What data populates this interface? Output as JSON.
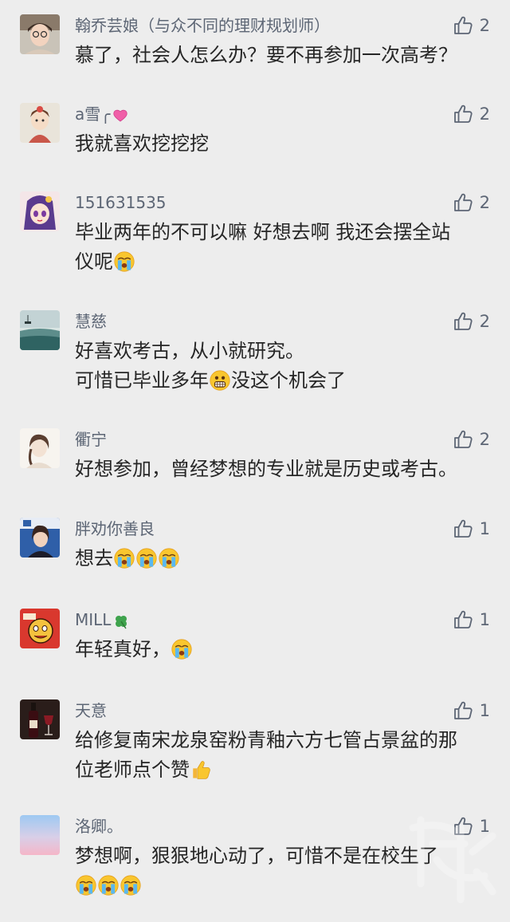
{
  "comments": [
    {
      "name": "翰乔芸娘（与众不同的理财规划师）",
      "likes": "2",
      "text_lines": [
        "慕了，社会人怎么办？要不再参加一次高考？"
      ],
      "avatar": "woman-glasses-avatar"
    },
    {
      "name": "a雪╭",
      "name_emoji": "pink-heart-icon",
      "likes": "2",
      "text_lines": [
        "我就喜欢挖挖挖"
      ],
      "avatar": "cartoon-girl-avatar"
    },
    {
      "name": "151631535",
      "likes": "2",
      "text_lines": [
        "毕业两年的不可以嘛 好想去啊 我还会摆全站",
        "仪呢"
      ],
      "emojis": [
        "crying-face-emoji"
      ],
      "avatar": "anime-girl-avatar"
    },
    {
      "name": "慧慈",
      "likes": "2",
      "text_lines": [
        "好喜欢考古，从小就研究。",
        "可惜已毕业多年",
        "没这个机会了"
      ],
      "emojis": [
        "grimace-face-emoji"
      ],
      "avatar": "lake-landscape-avatar"
    },
    {
      "name": "衢宁",
      "likes": "2",
      "text_lines": [
        "好想参加，曾经梦想的专业就是历史或考古。"
      ],
      "avatar": "woman-sketch-avatar"
    },
    {
      "name": "胖劝你善良",
      "likes": "1",
      "text_lines": [
        "想去"
      ],
      "emojis": [
        "crying-face-emoji",
        "crying-face-emoji",
        "crying-face-emoji"
      ],
      "avatar": "anchor-woman-avatar"
    },
    {
      "name": "MILL",
      "name_emoji": "four-leaf-clover-icon",
      "likes": "1",
      "text_lines": [
        "年轻真好，"
      ],
      "emojis": [
        "crying-face-emoji"
      ],
      "avatar": "cartoon-face-avatar"
    },
    {
      "name": "天意",
      "likes": "1",
      "text_lines": [
        "给修复南宋龙泉窑粉青釉六方七管占景盆的那",
        "位老师点个赞"
      ],
      "emojis": [
        "thumbs-up-emoji"
      ],
      "avatar": "wine-bottle-avatar"
    },
    {
      "name": "洛卿。",
      "likes": "1",
      "text_lines": [
        "梦想啊，狠狠地心动了，可惜不是在校生了"
      ],
      "emojis": [
        "crying-face-emoji",
        "crying-face-emoji",
        "crying-face-emoji"
      ],
      "avatar": "gradient-sky-avatar"
    }
  ],
  "colors": {
    "background": "#ededed",
    "name_text": "#5d6675",
    "body_text": "#262626",
    "like_icon": "#5d6675"
  }
}
